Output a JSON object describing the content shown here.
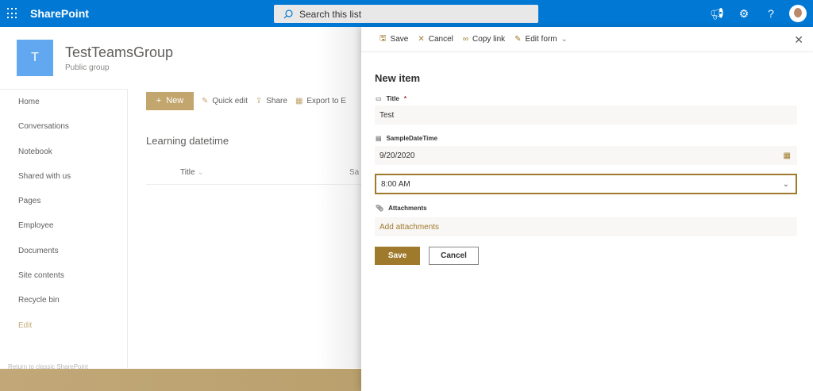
{
  "topbar": {
    "brand": "SharePoint",
    "search_placeholder": "Search this list"
  },
  "site": {
    "logo_letter": "T",
    "name": "TestTeamsGroup",
    "subtitle": "Public group"
  },
  "nav": {
    "items": [
      "Home",
      "Conversations",
      "Notebook",
      "Shared with us",
      "Pages",
      "Employee",
      "Documents",
      "Site contents",
      "Recycle bin"
    ],
    "edit": "Edit",
    "classic": "Return to classic SharePoint"
  },
  "commands": {
    "new": "New",
    "quick_edit": "Quick edit",
    "share": "Share",
    "export": "Export to E"
  },
  "list": {
    "title": "Learning datetime",
    "columns": [
      "Title",
      "Sa"
    ]
  },
  "panel": {
    "toolbar": {
      "save": "Save",
      "cancel": "Cancel",
      "copy_link": "Copy link",
      "edit_form": "Edit form"
    },
    "heading": "New item",
    "fields": {
      "title_label": "Title",
      "required_mark": "*",
      "title_value": "Test",
      "datetime_label": "SampleDateTime",
      "date_value": "9/20/2020",
      "time_value": "8:00 AM",
      "attachments_label": "Attachments",
      "add_attachments": "Add attachments"
    },
    "save_button": "Save",
    "cancel_button": "Cancel"
  },
  "colors": {
    "brand_blue": "#0078d4",
    "accent_gold": "#a07a2c"
  }
}
